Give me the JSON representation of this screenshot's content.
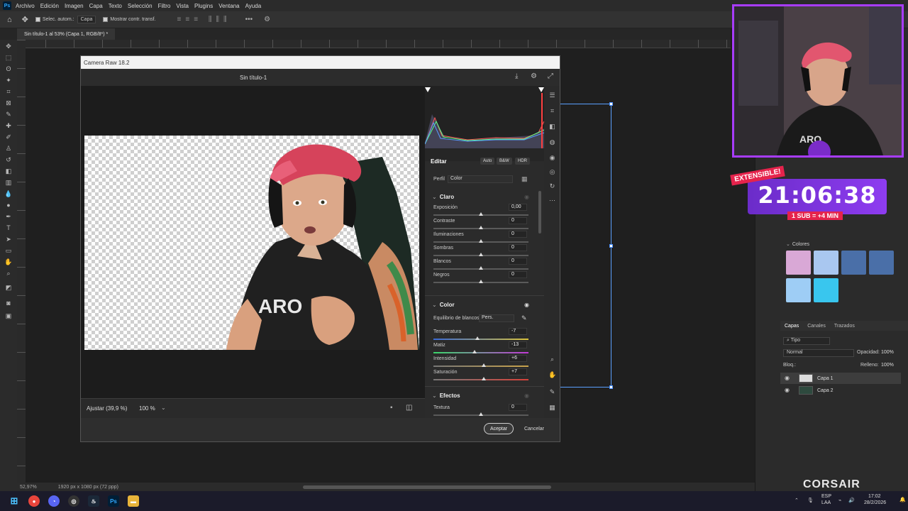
{
  "menubar": {
    "app_logo": "Ps",
    "items": [
      "Archivo",
      "Edición",
      "Imagen",
      "Capa",
      "Texto",
      "Selección",
      "Filtro",
      "Vista",
      "Plugins",
      "Ventana",
      "Ayuda"
    ]
  },
  "options_bar": {
    "auto_select_label": "Selec. autom.:",
    "auto_select_value": "Capa",
    "show_transform_label": "Mostrar contr. transf."
  },
  "doc_tab": {
    "label": "Sin título-1 al 53% (Capa 1, RGB/8*) *"
  },
  "status": {
    "zoom": "52,97%",
    "doc_size": "1920 px x 1080 px (72 ppp)"
  },
  "camera_raw": {
    "window_title": "Camera Raw 18.2",
    "doc_title": "Sin título-1",
    "footer": {
      "fit": "Ajustar (39,9 %)",
      "zoom": "100 %"
    },
    "buttons": {
      "accept": "Aceptar",
      "cancel": "Cancelar"
    },
    "edit": {
      "title": "Editar",
      "auto": "Auto",
      "bw": "B&W",
      "hdr": "HDR",
      "profile_label": "Perfil",
      "profile_value": "Color"
    },
    "sections": {
      "light": {
        "title": "Claro",
        "sliders": [
          {
            "label": "Exposición",
            "value": "0,00",
            "pos": 0.5
          },
          {
            "label": "Contraste",
            "value": "0",
            "pos": 0.5
          },
          {
            "label": "Iluminaciones",
            "value": "0",
            "pos": 0.5
          },
          {
            "label": "Sombras",
            "value": "0",
            "pos": 0.5
          },
          {
            "label": "Blancos",
            "value": "0",
            "pos": 0.5
          },
          {
            "label": "Negros",
            "value": "0",
            "pos": 0.5
          }
        ]
      },
      "color": {
        "title": "Color",
        "wb_label": "Equilibrio de blancos",
        "wb_value": "Pers.",
        "sliders": [
          {
            "label": "Temperatura",
            "value": "-7",
            "pos": 0.46
          },
          {
            "label": "Matiz",
            "value": "-13",
            "pos": 0.43
          },
          {
            "label": "Intensidad",
            "value": "+6",
            "pos": 0.53
          },
          {
            "label": "Saturación",
            "value": "+7",
            "pos": 0.53
          }
        ]
      },
      "effects": {
        "title": "Efectos",
        "sliders": [
          {
            "label": "Textura",
            "value": "0",
            "pos": 0.5
          }
        ]
      }
    }
  },
  "panels": {
    "swatches_title": "Colores",
    "swatches": [
      "#d9a8d6",
      "#a9c7f0",
      "#4a6fa8",
      "#4a6fa8",
      "#9ecdf5",
      "#39c6ee"
    ],
    "layers_tabs": [
      "Capas",
      "Canales",
      "Trazados"
    ],
    "filter": "Tipo",
    "blend_mode": "Normal",
    "opacity_label": "Opacidad:",
    "opacity_value": "100%",
    "lock_label": "Bloq.:",
    "fill_label": "Relleno:",
    "fill_value": "100%",
    "layers": [
      "Capa 1",
      "Capa 2"
    ]
  },
  "stream": {
    "extensible": "EXTENSIBLE!",
    "timer": "21:06:38",
    "sub_rule": "1 SUB = +4 MIN",
    "brand": "CORSAIR"
  },
  "tray": {
    "lang": "ESP",
    "region": "LAA",
    "time": "17:02",
    "date": "28/2/2026"
  }
}
